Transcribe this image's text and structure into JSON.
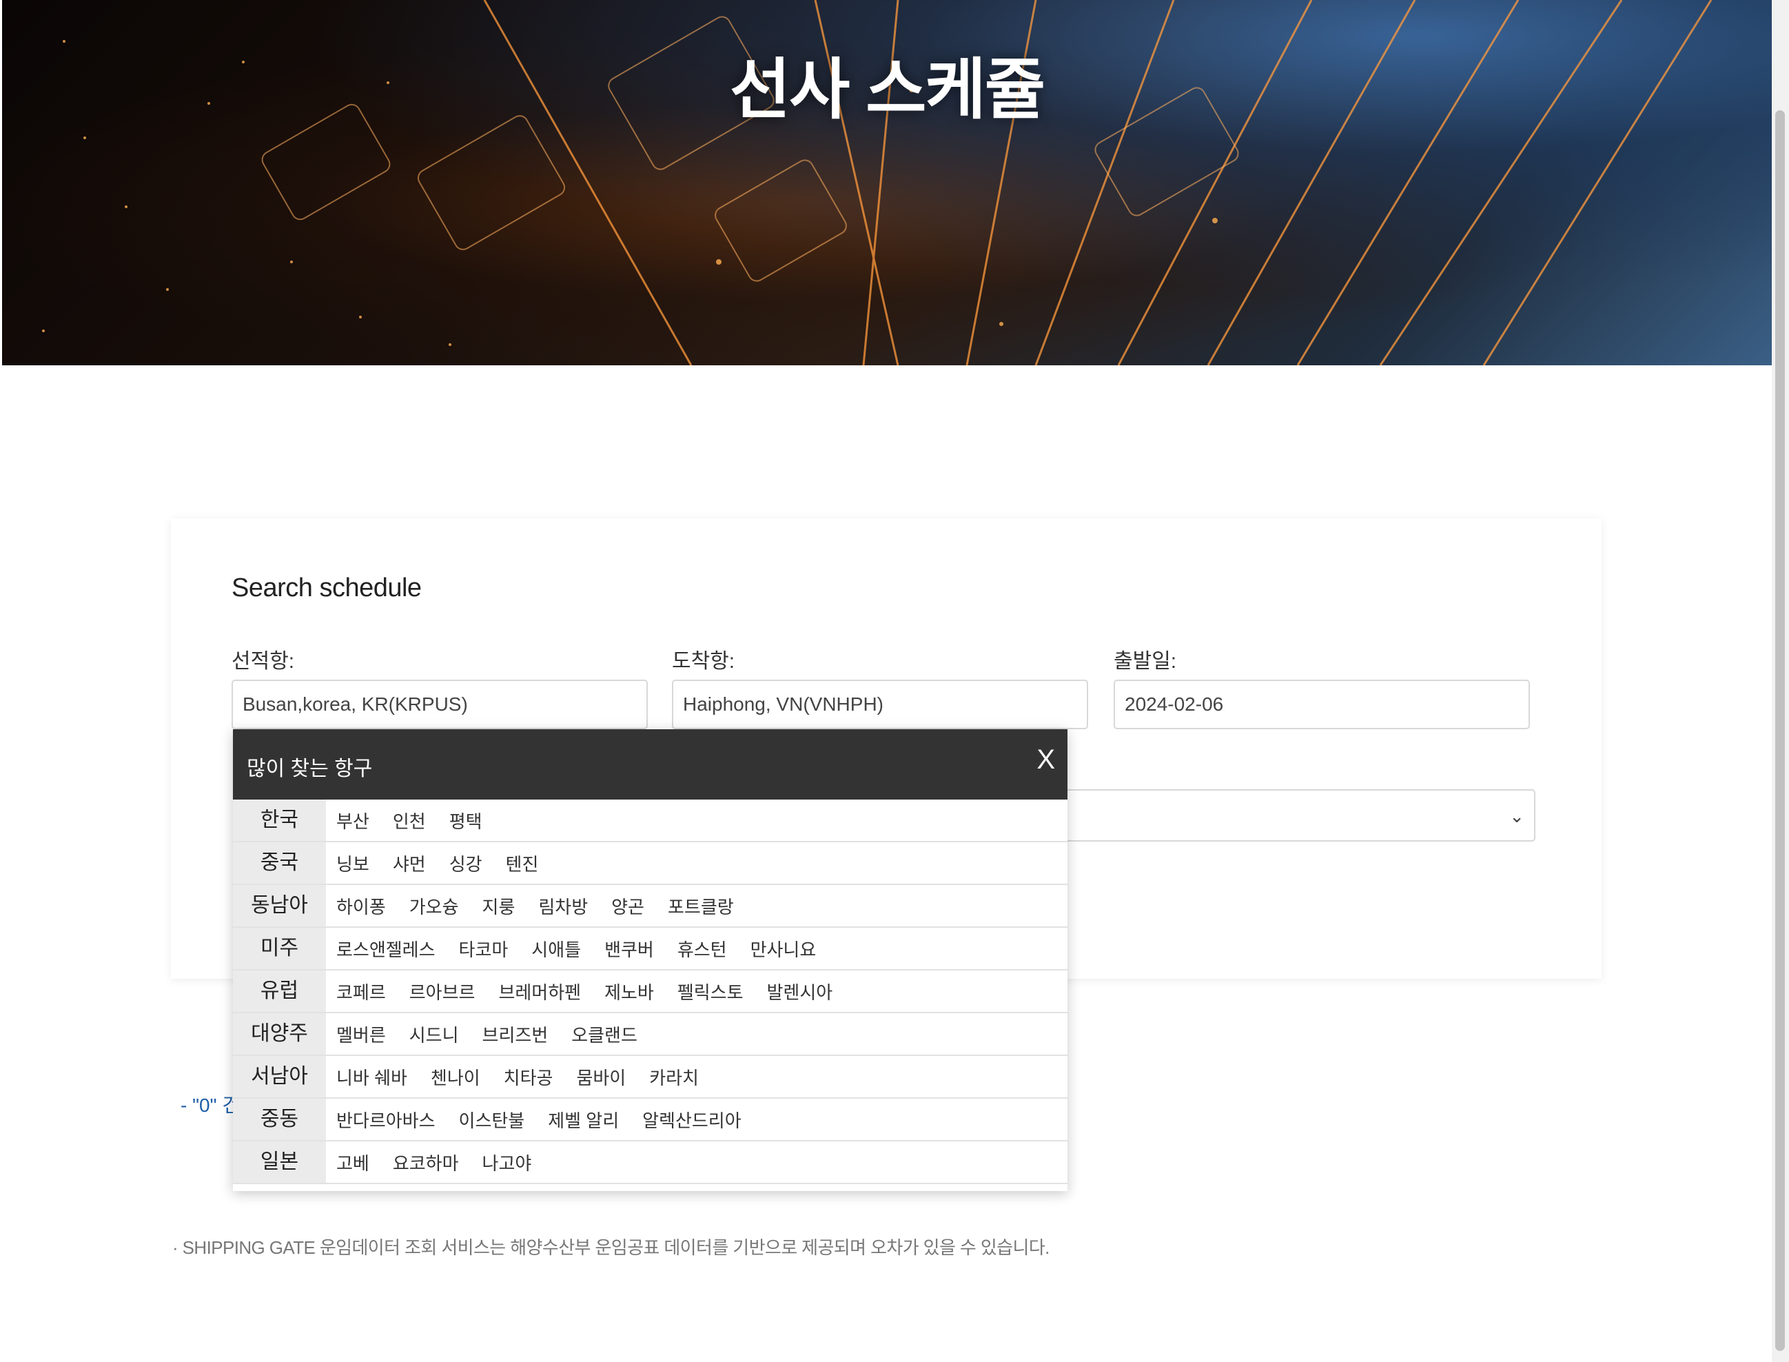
{
  "hero": {
    "title": "선사 스케쥴"
  },
  "search": {
    "title": "Search schedule",
    "origin": {
      "label": "선적항:",
      "value": "Busan,korea, KR(KRPUS)"
    },
    "destination": {
      "label": "도착항:",
      "value": "Haiphong, VN(VNHPH)"
    },
    "departure": {
      "label": "출발일:",
      "value": "2024-02-06"
    }
  },
  "result_note": "- \"0\" 건",
  "footer_note": "· SHIPPING GATE 운임데이터 조회 서비스는 해양수산부 운임공표 데이터를 기반으로 제공되며 오차가 있을 수 있습니다.",
  "popup": {
    "title": "많이 찾는 항구",
    "close": "X",
    "regions": [
      {
        "name": "한국",
        "ports": [
          "부산",
          "인천",
          "평택"
        ]
      },
      {
        "name": "중국",
        "ports": [
          "닝보",
          "샤먼",
          "싱강",
          "텐진"
        ]
      },
      {
        "name": "동남아",
        "ports": [
          "하이퐁",
          "가오슝",
          "지룽",
          "림차방",
          "양곤",
          "포트클랑"
        ]
      },
      {
        "name": "미주",
        "ports": [
          "로스앤젤레스",
          "타코마",
          "시애틀",
          "밴쿠버",
          "휴스턴",
          "만사니요"
        ]
      },
      {
        "name": "유럽",
        "ports": [
          "코페르",
          "르아브르",
          "브레머하펜",
          "제노바",
          "펠릭스토",
          "발렌시아"
        ]
      },
      {
        "name": "대양주",
        "ports": [
          "멜버른",
          "시드니",
          "브리즈번",
          "오클랜드"
        ]
      },
      {
        "name": "서남아",
        "ports": [
          "니바 쉐바",
          "첸나이",
          "치타공",
          "뭄바이",
          "카라치"
        ]
      },
      {
        "name": "중동",
        "ports": [
          "반다르아바스",
          "이스탄불",
          "제벨 알리",
          "알렉산드리아"
        ]
      },
      {
        "name": "일본",
        "ports": [
          "고베",
          "요코하마",
          "나고야"
        ]
      }
    ]
  }
}
